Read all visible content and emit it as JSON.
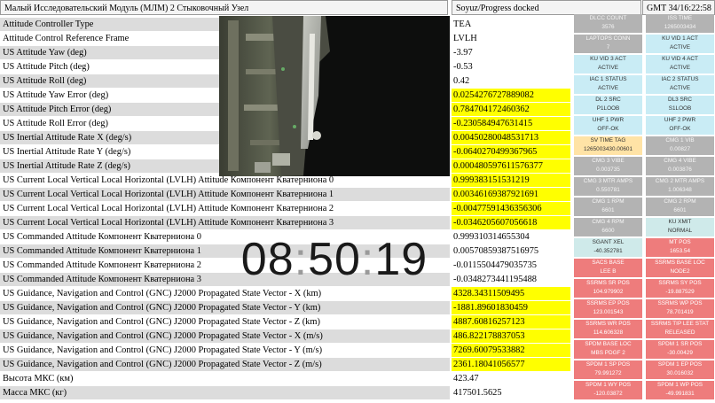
{
  "header": {
    "module": "Малый Исследовательский Модуль (МЛМ) 2 Стыковочный Узел",
    "status": "Soyuz/Progress docked",
    "gmt": "GMT 34/16:22:58"
  },
  "rows": [
    {
      "label": "Attitude Controller Type",
      "value": "TEA",
      "hl": false
    },
    {
      "label": "Attitude Control Reference Frame",
      "value": "LVLH",
      "hl": false
    },
    {
      "label": "US Attitude Yaw (deg)",
      "value": "-3.97",
      "hl": false
    },
    {
      "label": "US Attitude Pitch (deg)",
      "value": "-0.53",
      "hl": false
    },
    {
      "label": "US Attitude Roll (deg)",
      "value": "0.42",
      "hl": false
    },
    {
      "label": "US Attitude Yaw Error (deg)",
      "value": "0.0254276727889082",
      "hl": true
    },
    {
      "label": "US Attitude Pitch Error (deg)",
      "value": "0.784704172460362",
      "hl": true
    },
    {
      "label": "US Attitude Roll Error (deg)",
      "value": "-0.230584947631415",
      "hl": true
    },
    {
      "label": "US Inertial Attitude Rate X (deg/s)",
      "value": "0.00450280048531713",
      "hl": true
    },
    {
      "label": "US Inertial Attitude Rate Y (deg/s)",
      "value": "-0.0640270499367965",
      "hl": true
    },
    {
      "label": "US Inertial Attitude Rate Z (deg/s)",
      "value": "0.000480597611576377",
      "hl": true
    },
    {
      "label": "US Current Local Vertical Local Horizontal (LVLH) Attitude Компонент Кватерниона 0",
      "value": "0.999383151531219",
      "hl": true
    },
    {
      "label": "US Current Local Vertical Local Horizontal (LVLH) Attitude Компонент Кватерниона 1",
      "value": "0.00346169387921691",
      "hl": true
    },
    {
      "label": "US Current Local Vertical Local Horizontal (LVLH) Attitude Компонент Кватерниона 2",
      "value": "-0.00477591436356306",
      "hl": true
    },
    {
      "label": "US Current Local Vertical Local Horizontal (LVLH) Attitude Компонент Кватерниона 3",
      "value": "-0.0346205607056618",
      "hl": true
    },
    {
      "label": "US Commanded Attitude Компонент Кватерниона 0",
      "value": "0.999310314655304",
      "hl": false
    },
    {
      "label": "US Commanded Attitude Компонент Кватерниона 1",
      "value": "0.00570859387516975",
      "hl": false
    },
    {
      "label": "US Commanded Attitude Компонент Кватерниона 2",
      "value": "-0.0115504479035735",
      "hl": false
    },
    {
      "label": "US Commanded Attitude Компонент Кватерниона 3",
      "value": "-0.0348273441195488",
      "hl": false
    },
    {
      "label": "US Guidance, Navigation and Control (GNC) J2000 Propagated State Vector - X (km)",
      "value": "4328.34311509495",
      "hl": true
    },
    {
      "label": "US Guidance, Navigation and Control (GNC) J2000 Propagated State Vector - Y (km)",
      "value": "-1881.89601830459",
      "hl": true
    },
    {
      "label": "US Guidance, Navigation and Control (GNC) J2000 Propagated State Vector - Z (km)",
      "value": "4887.60816257123",
      "hl": true
    },
    {
      "label": "US Guidance, Navigation and Control (GNC) J2000 Propagated State Vector - X (m/s)",
      "value": "486.822178837053",
      "hl": true
    },
    {
      "label": "US Guidance, Navigation and Control (GNC) J2000 Propagated State Vector - Y (m/s)",
      "value": "7269.60079533882",
      "hl": true
    },
    {
      "label": "US Guidance, Navigation and Control (GNC) J2000 Propagated State Vector - Z (m/s)",
      "value": "2361.18041056577",
      "hl": true
    },
    {
      "label": "Высота МКС (км)",
      "value": "423.47",
      "hl": false
    },
    {
      "label": "Масса МКС (кг)",
      "value": "417501.5625",
      "hl": false
    }
  ],
  "clock": {
    "hh": "08",
    "mm": "50",
    "ss": "19",
    "sep": ":"
  },
  "grid": [
    [
      {
        "t": "DLCC COUNT",
        "v": "3576",
        "c": "gray"
      },
      {
        "t": "ISS TIME",
        "v": "1265003434",
        "c": "gray"
      }
    ],
    [
      {
        "t": "LAPTOPS CONN",
        "v": "7",
        "c": "gray"
      },
      {
        "t": "KU VID 1 ACT",
        "v": "ACTIVE",
        "c": "blue"
      }
    ],
    [
      {
        "t": "KU VID 3 ACT",
        "v": "ACTIVE",
        "c": "blue"
      },
      {
        "t": "KU VID 4 ACT",
        "v": "ACTIVE",
        "c": "blue"
      }
    ],
    [
      {
        "t": "IAC 1 STATUS",
        "v": "ACTIVE",
        "c": "blue"
      },
      {
        "t": "IAC 2 STATUS",
        "v": "ACTIVE",
        "c": "blue"
      }
    ],
    [
      {
        "t": "DL 2 SRC",
        "v": "P1LOOB",
        "c": "blue"
      },
      {
        "t": "DL3 SRC",
        "v": "S1LOOB",
        "c": "blue"
      }
    ],
    [
      {
        "t": "UHF 1 PWR",
        "v": "OFF-OK",
        "c": "blue"
      },
      {
        "t": "UHF 2 PWR",
        "v": "OFF-OK",
        "c": "blue"
      }
    ],
    [
      {
        "t": "SV TIME TAG",
        "v": "1265003430.00601",
        "c": "tan"
      },
      {
        "t": "CMG 1 VIB",
        "v": "0.00827",
        "c": "gray"
      }
    ],
    [
      {
        "t": "CMG 3 VIBE",
        "v": "0.003735",
        "c": "gray"
      },
      {
        "t": "CMG 4 VIBE",
        "v": "0.003876",
        "c": "gray"
      }
    ],
    [
      {
        "t": "CMG 3 MTR AMPS",
        "v": "0.550781",
        "c": "gray"
      },
      {
        "t": "CMG 2 MTR AMPS",
        "v": "1.006348",
        "c": "gray"
      }
    ],
    [
      {
        "t": "CMG 1 RPM",
        "v": "6601",
        "c": "gray"
      },
      {
        "t": "CMG 2 RPM",
        "v": "6601",
        "c": "gray"
      }
    ],
    [
      {
        "t": "CMG 4 RPM",
        "v": "6600",
        "c": "gray"
      },
      {
        "t": "KU XMIT",
        "v": "NORMAL",
        "c": "pale"
      }
    ],
    [
      {
        "t": "SGANT XEL",
        "v": "-40.352781",
        "c": "pale"
      },
      {
        "t": "MT POS",
        "v": "1653.54",
        "c": "red"
      }
    ],
    [
      {
        "t": "SACS BASE",
        "v": "LEE B",
        "c": "red"
      },
      {
        "t": "SSRMS BASE LOC",
        "v": "NODE2",
        "c": "red"
      }
    ],
    [
      {
        "t": "SSRMS SR POS",
        "v": "104.979902",
        "c": "red"
      },
      {
        "t": "SSRMS SY POS",
        "v": "-19.887529",
        "c": "red"
      }
    ],
    [
      {
        "t": "SSRMS EP POS",
        "v": "123.001543",
        "c": "red"
      },
      {
        "t": "SSRMS WP POS",
        "v": "78.701419",
        "c": "red"
      }
    ],
    [
      {
        "t": "SSRMS WR POS",
        "v": "114.606328",
        "c": "red"
      },
      {
        "t": "SSRMS TIP LEE STAT",
        "v": "RELEASED",
        "c": "red"
      }
    ],
    [
      {
        "t": "SPDM BASE LOC",
        "v": "MBS PDGF 2",
        "c": "red"
      },
      {
        "t": "SPDM 1 SR POS",
        "v": "-30.00429",
        "c": "red"
      }
    ],
    [
      {
        "t": "SPDM 1 SP POS",
        "v": "79.991272",
        "c": "red"
      },
      {
        "t": "SPDM 1 EP POS",
        "v": "30.016032",
        "c": "red"
      }
    ],
    [
      {
        "t": "SPDM 1 WY POS",
        "v": "-120.03872",
        "c": "red"
      },
      {
        "t": "SPDM 1 WP POS",
        "v": "-49.991831",
        "c": "red"
      }
    ]
  ]
}
